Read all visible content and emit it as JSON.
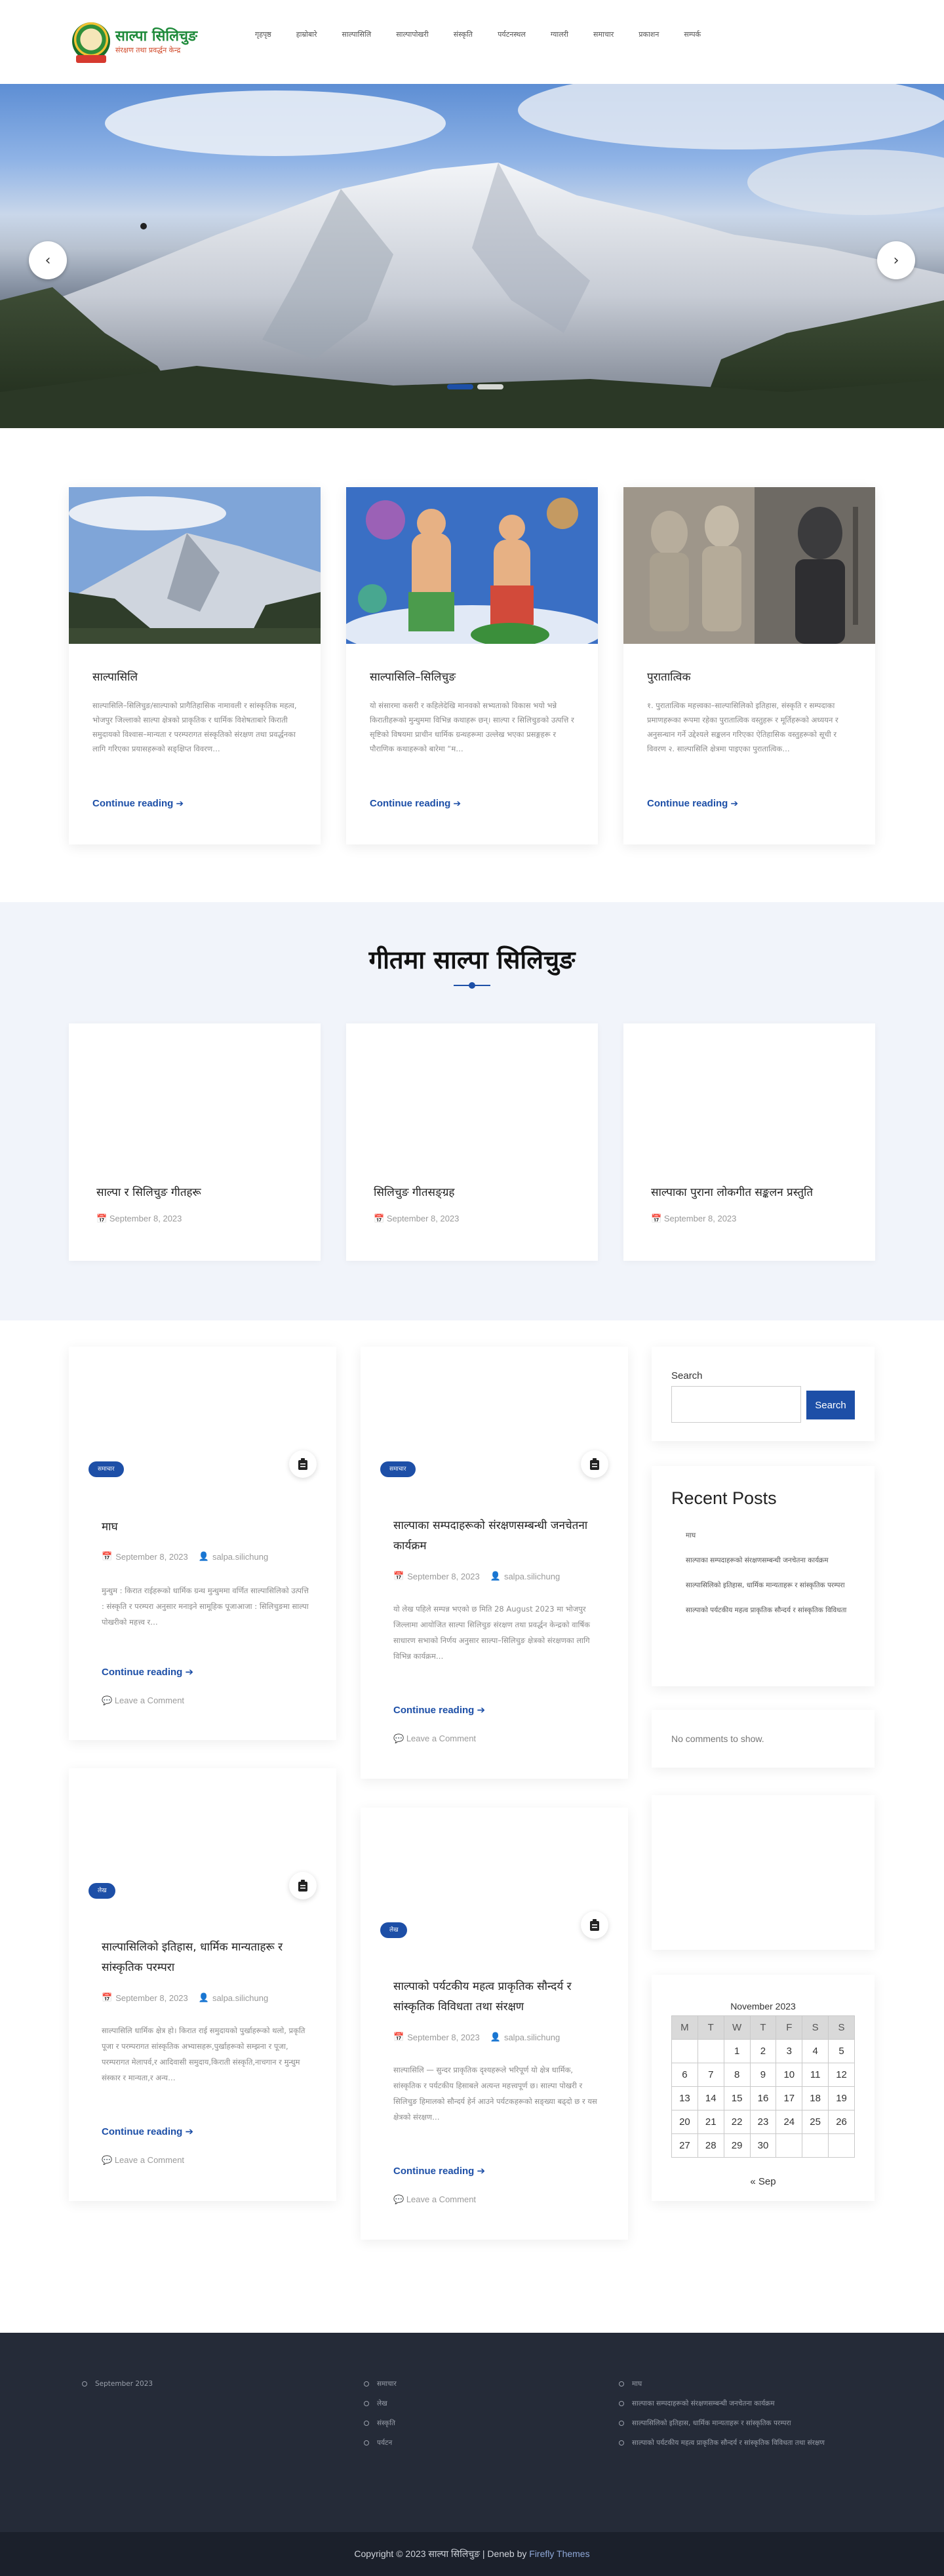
{
  "header": {
    "logo": {
      "title": "साल्पा सिलिचुङ",
      "subtitle": "संरक्षण तथा प्रवर्द्धन केन्द्र"
    },
    "nav": [
      "गृहपृष्ठ",
      "हाम्रोबारे",
      "साल्पासिलि",
      "साल्पापोखरी",
      "संस्कृति",
      "पर्यटनस्थल",
      "ग्यालरी",
      "समाचार",
      "प्रकाशन",
      "सम्पर्क"
    ]
  },
  "hero": {
    "prev_icon": "chevron-left-icon",
    "next_icon": "chevron-right-icon",
    "prev_glyph": "‹",
    "next_glyph": "›",
    "active_slide": 1,
    "slides": 2
  },
  "features": [
    {
      "title": "साल्पासिलि",
      "text": "साल्पासिलि–सिलिचुङ/साल्पाको प्रागैतिहासिक नामावली र सांस्कृतिक महत्व, भोजपुर जिल्लाको साल्पा क्षेत्रको प्राकृतिक र धार्मिक विशेषताबारे किराती समुदायको विश्वास–मान्यता र परम्परागत संस्कृतिको संरक्षण तथा प्रवर्द्धनका लागि गरिएका प्रयासहरूको सङ्क्षिप्त विवरण…",
      "read_more": "Continue reading"
    },
    {
      "title": "साल्पासिलि–सिलिचुङ",
      "text": "यो संसारमा कसरी र कहिलेदेखि मानवको सभ्यताको विकास भयो भन्ने किरातीहरूको मुन्धुममा विभिन्न कथाहरू छन्। साल्पा र सिलिचुङको उत्पत्ति र सृष्टिको विषयमा प्राचीन धार्मिक ग्रन्थहरूमा उल्लेख भएका प्रसङ्गहरू र पौराणिक कथाहरूको बारेमा “म…",
      "read_more": "Continue reading"
    },
    {
      "title": "पुरातात्विक",
      "text": "१. पुरातात्विक महत्त्वका–साल्पासिलिको इतिहास, संस्कृति र सम्पदाका प्रमाणहरूका रूपमा रहेका पुरातात्विक वस्तुहरू र मूर्तिहरूको अध्ययन र अनुसन्धान गर्ने उद्देश्यले सङ्कलन गरिएका ऐतिहासिक वस्तुहरूको सूची र विवरण २. साल्पासिलि क्षेत्रमा पाइएका पुरातात्विक…",
      "read_more": "Continue reading"
    }
  ],
  "gita": {
    "title": "गीतमा साल्पा सिलिचुङ",
    "cards": [
      {
        "title": "साल्पा र सिलिचुङ गीतहरू",
        "date": "September 8, 2023"
      },
      {
        "title": "सिलिचुङ गीतसङ्ग्रह",
        "date": "September 8, 2023"
      },
      {
        "title": "साल्पाका पुराना लोकगीत सङ्कलन प्रस्तुति",
        "date": "September 8, 2023"
      }
    ]
  },
  "posts": [
    {
      "badge": "समाचार",
      "title": "माघ",
      "date": "September 8, 2023",
      "author": "salpa.silichung",
      "excerpt": "मुन्धुम : किरात राईहरूको धार्मिक ग्रन्थ मुन्धुममा वर्णित साल्पासिलिको उत्पत्ति : संस्कृति र परम्परा अनुसार मनाइने सामूहिक पूजाआजा : सिलिचुङमा साल्पा पोखरीको महत्त्व र…",
      "read_more": "Continue reading",
      "comment": "Leave a Comment"
    },
    {
      "badge": "समाचार",
      "title": "साल्पाका सम्पदाहरूको संरक्षणसम्बन्धी जनचेतना कार्यक्रम",
      "date": "September 8, 2023",
      "author": "salpa.silichung",
      "excerpt": "यो लेख पहिले सम्पन्न भएको छ मिति 28 August 2023 मा भोजपुर जिल्लामा आयोजित साल्पा सिलिचुङ संरक्षण तथा प्रवर्द्धन केन्द्रको वार्षिक साधारण सभाको निर्णय अनुसार साल्पा–सिलिचुङ क्षेत्रको संरक्षणका लागि विभिन्न कार्यक्रम…",
      "read_more": "Continue reading",
      "comment": "Leave a Comment"
    },
    {
      "badge": "लेख",
      "title": "साल्पासिलिको इतिहास, धार्मिक मान्यताहरू र सांस्कृतिक परम्परा",
      "date": "September 8, 2023",
      "author": "salpa.silichung",
      "excerpt": "साल्पासिलि धार्मिक क्षेत्र हो। किरात राई समुदायको पुर्खाहरूको थलो, प्रकृति पूजा र परम्परागत सांस्कृतिक अभ्यासहरू,पुर्खाहरूको सम्झना र पूजा, परम्परागत मेलापर्व,र आदिवासी समुदाय,किराती संस्कृति,नाचगान र मुन्धुम संस्कार र मान्यता,र अन्य…",
      "read_more": "Continue reading",
      "comment": "Leave a Comment"
    },
    {
      "badge": "लेख",
      "title": "साल्पाको पर्यटकीय महत्व प्राकृतिक सौन्दर्य र सांस्कृतिक विविधता तथा संरक्षण",
      "date": "September 8, 2023",
      "author": "salpa.silichung",
      "excerpt": "साल्पासिलि — सुन्दर प्राकृतिक दृश्यहरूले भरिपूर्ण यो क्षेत्र धार्मिक, सांस्कृतिक र पर्यटकीय हिसाबले अत्यन्त महत्त्वपूर्ण छ। साल्पा पोखरी र सिलिचुङ हिमालको सौन्दर्य हेर्न आउने पर्यटकहरूको सङ्ख्या बढ्दो छ र यस क्षेत्रको संरक्षण…",
      "read_more": "Continue reading",
      "comment": "Leave a Comment"
    }
  ],
  "sidebar": {
    "search": {
      "label": "Search",
      "placeholder": "",
      "value": "",
      "button": "Search"
    },
    "recent": {
      "title": "Recent Posts",
      "items": [
        "माघ",
        "साल्पाका सम्पदाहरूको संरक्षणसम्बन्धी जनचेतना कार्यक्रम",
        "साल्पासिलिको इतिहास, धार्मिक मान्यताहरू र सांस्कृतिक परम्परा",
        "साल्पाको पर्यटकीय महत्व प्राकृतिक सौन्दर्य र सांस्कृतिक विविधता"
      ]
    },
    "comments": {
      "empty": "No comments to show."
    },
    "calendar": {
      "caption": "November 2023",
      "headers": [
        "M",
        "T",
        "W",
        "T",
        "F",
        "S",
        "S"
      ],
      "weeks": [
        [
          "",
          "",
          "1",
          "2",
          "3",
          "4",
          "5"
        ],
        [
          "6",
          "7",
          "8",
          "9",
          "10",
          "11",
          "12"
        ],
        [
          "13",
          "14",
          "15",
          "16",
          "17",
          "18",
          "19"
        ],
        [
          "20",
          "21",
          "22",
          "23",
          "24",
          "25",
          "26"
        ],
        [
          "27",
          "28",
          "29",
          "30",
          "",
          "",
          ""
        ]
      ],
      "prev": "« Sep"
    }
  },
  "footer": {
    "col1": [
      "September 2023"
    ],
    "col2": [
      "समाचार",
      "लेख",
      "संस्कृति",
      "पर्यटन"
    ],
    "col3": [
      "माघ",
      "साल्पाका सम्पदाहरूको संरक्षणसम्बन्धी जनचेतना कार्यक्रम",
      "साल्पासिलिको इतिहास, धार्मिक मान्यताहरू र सांस्कृतिक परम्परा",
      "साल्पाको पर्यटकीय महत्व प्राकृतिक सौन्दर्य र सांस्कृतिक विविधता तथा संरक्षण"
    ],
    "copyright_prefix": "Copyright © 2023 साल्पा सिलिचुङ | Deneb by",
    "copyright_link": "Firefly Themes"
  },
  "colors": {
    "accent": "#1d4fa7",
    "footer": "#252b38",
    "gita_bg": "#f1f4fa"
  },
  "icons": {
    "calendar": "calendar-icon",
    "author": "user-icon",
    "comment": "comment-icon",
    "post_format": "clipboard-icon",
    "arrow": "arrow-right-icon"
  }
}
